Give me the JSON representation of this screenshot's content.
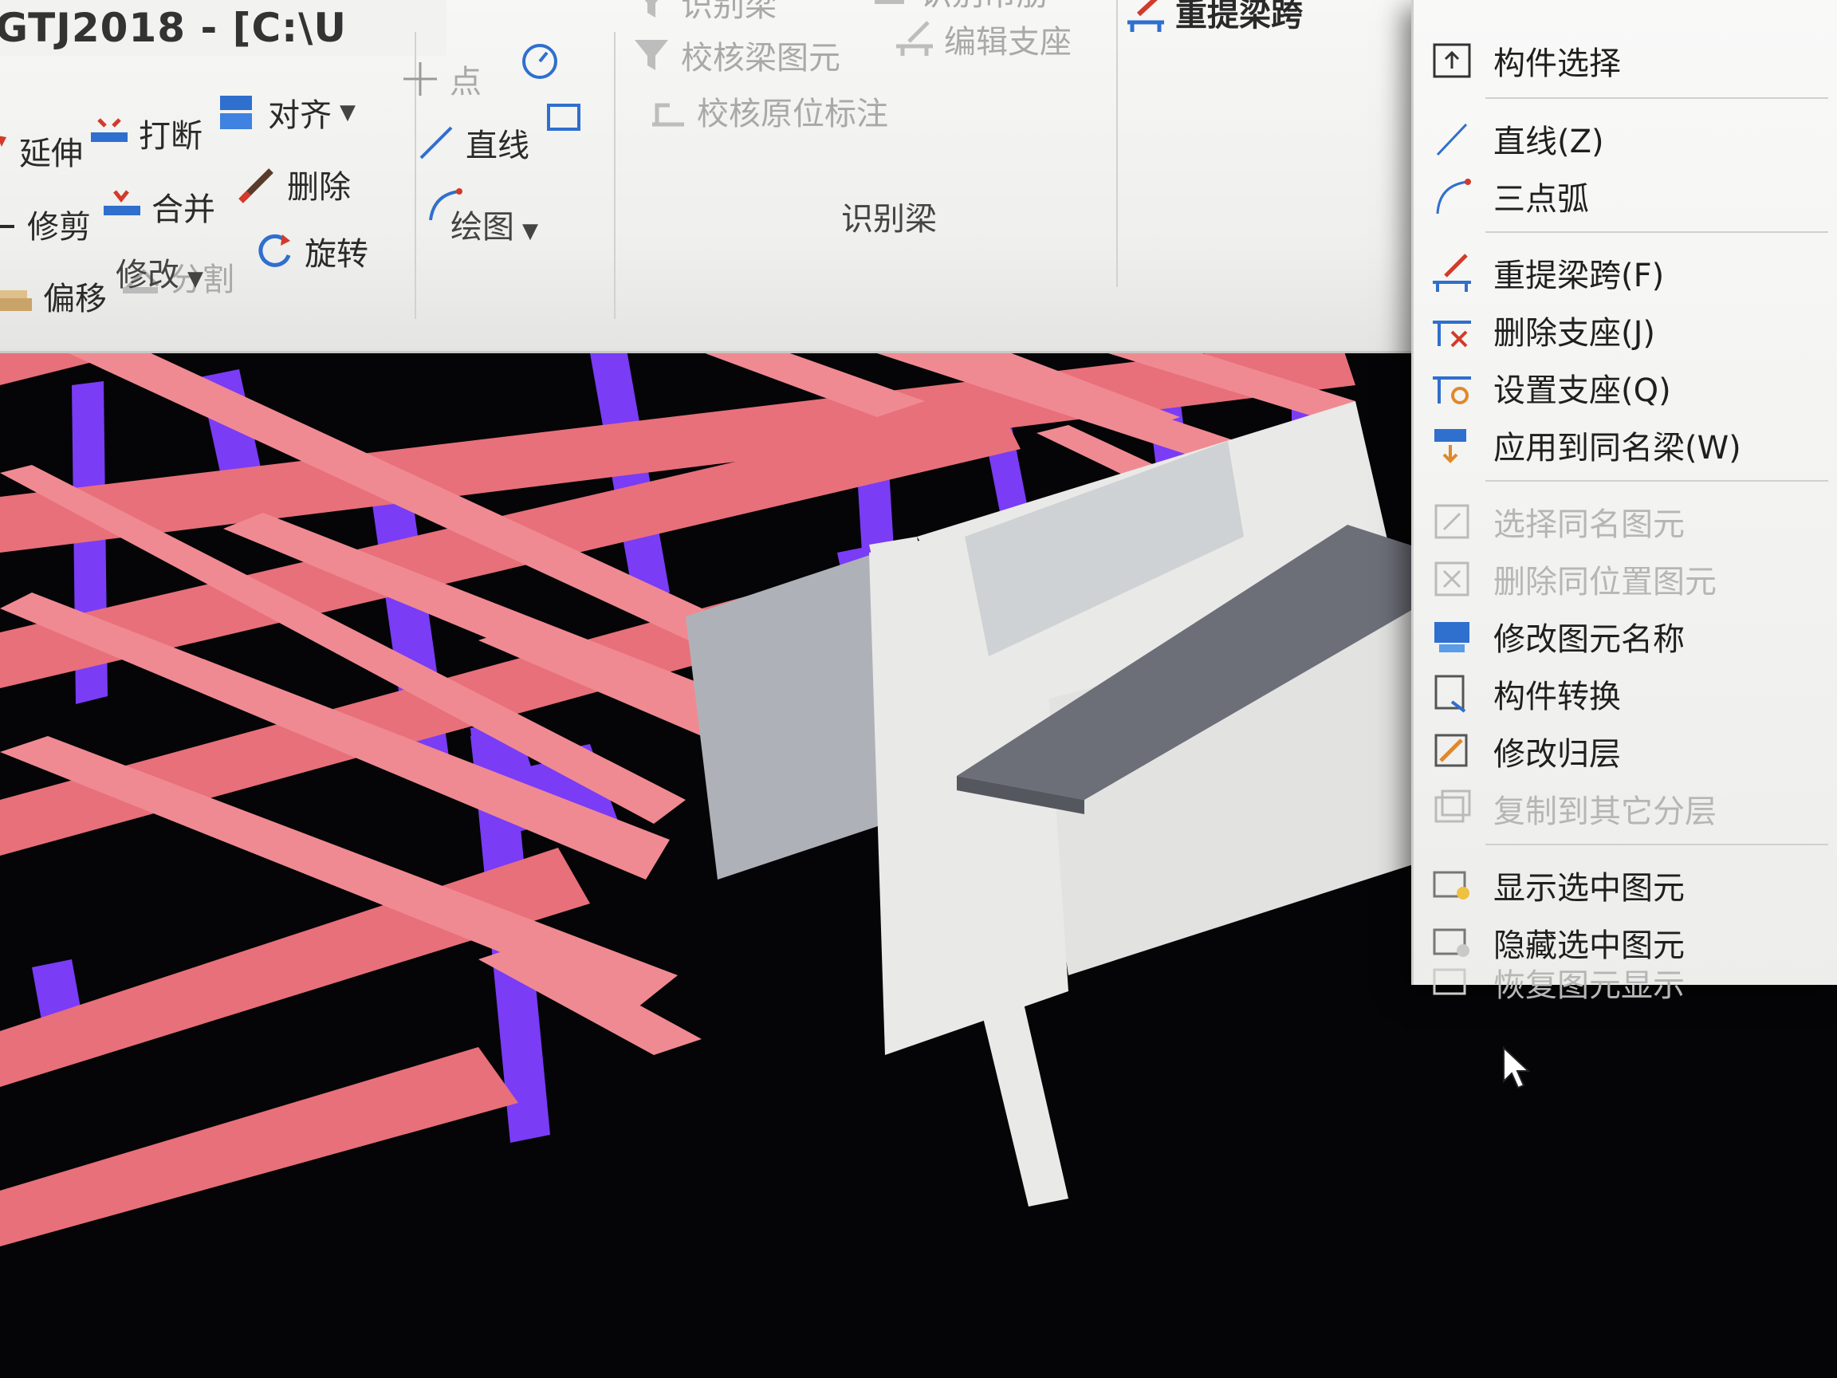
{
  "window": {
    "title": "GTJ2018 - [C:\\U"
  },
  "ribbon": {
    "modify": {
      "label": "修改",
      "items": [
        "延伸",
        "打断",
        "对齐",
        "修剪",
        "合并",
        "删除",
        "偏移",
        "分割",
        "旋转"
      ]
    },
    "draw": {
      "label": "绘图",
      "items": [
        "点",
        "直线"
      ]
    },
    "identify_beam": {
      "label": "识别梁",
      "items": [
        "识别梁",
        "识别吊筋",
        "校核梁图元",
        "编辑支座",
        "校核原位标注"
      ]
    },
    "extra": {
      "items": [
        "重提梁跨"
      ]
    }
  },
  "context_menu": {
    "items": [
      {
        "label": "构件选择",
        "enabled": true
      },
      {
        "label": "直线(Z)",
        "enabled": true
      },
      {
        "label": "三点弧",
        "enabled": true
      },
      {
        "label": "重提梁跨(F)",
        "enabled": true
      },
      {
        "label": "删除支座(J)",
        "enabled": true
      },
      {
        "label": "设置支座(Q)",
        "enabled": true
      },
      {
        "label": "应用到同名梁(W)",
        "enabled": true
      },
      {
        "label": "选择同名图元",
        "enabled": false
      },
      {
        "label": "删除同位置图元",
        "enabled": false
      },
      {
        "label": "修改图元名称",
        "enabled": true
      },
      {
        "label": "构件转换",
        "enabled": true
      },
      {
        "label": "修改归层",
        "enabled": true
      },
      {
        "label": "复制到其它分层",
        "enabled": false
      },
      {
        "label": "显示选中图元",
        "enabled": true
      },
      {
        "label": "隐藏选中图元",
        "enabled": true
      },
      {
        "label": "恢复图元显示",
        "enabled": false
      }
    ]
  },
  "colors": {
    "beam": "#e8707a",
    "beam_top": "#f08a92",
    "column": "#7a3cf5",
    "wall": "#e9e9e7",
    "slab": "#6c6f78",
    "accent": "#2f6fce"
  }
}
